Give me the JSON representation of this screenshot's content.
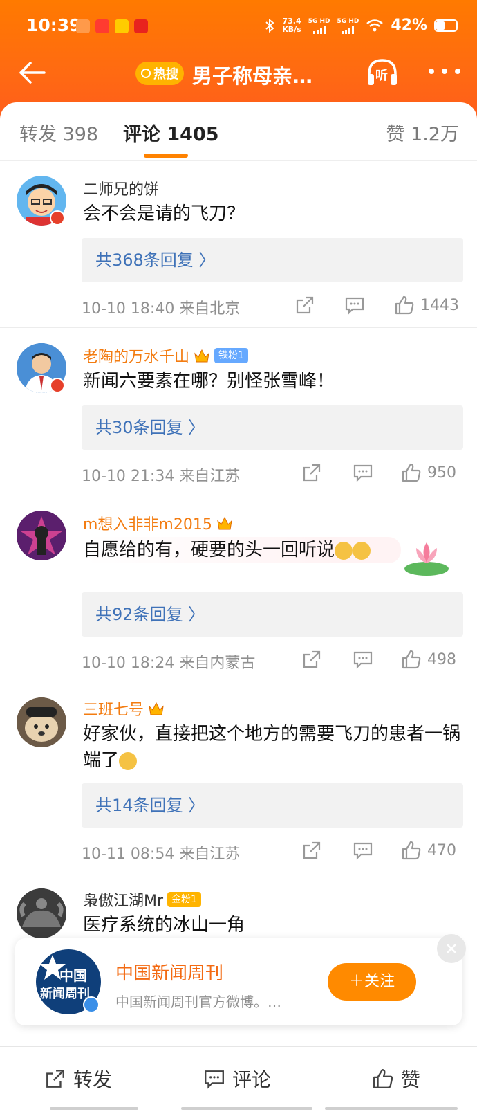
{
  "status_bar": {
    "time": "10:39",
    "net_speed": "73.4",
    "net_unit": "KB/s",
    "sig1": "5G HD",
    "sig2": "5G HD",
    "battery": "42%",
    "battery_level": 0.42
  },
  "nav": {
    "hot_label": "热搜",
    "title": "男子称母亲…",
    "listen_label": "听"
  },
  "tabs": {
    "repost": "转发 398",
    "comment": "评论 1405",
    "like": "赞 1.2万"
  },
  "comments": [
    {
      "user": "二师兄的饼",
      "text": "会不会是请的飞刀？",
      "replies": "共368条回复 〉",
      "meta": "10-10 18:40  来自北京",
      "likes": "1443"
    },
    {
      "user": "老陶的万水千山",
      "fan_tag": "铁粉1",
      "text": "新闻六要素在哪？别怪张雪峰！",
      "replies": "共30条回复 〉",
      "meta": "10-10 21:34  来自江苏",
      "likes": "950"
    },
    {
      "user": "m想入非非m2015",
      "text": "自愿给的有，硬要的头一回听说",
      "replies": "共92条回复 〉",
      "meta": "10-10 18:24  来自内蒙古",
      "likes": "498"
    },
    {
      "user": "三班七号",
      "text": "好家伙，直接把这个地方的需要飞刀的患者一锅端了",
      "replies": "共14条回复 〉",
      "meta": "10-11 08:54  来自江苏",
      "likes": "470"
    },
    {
      "user": "枭傲江湖Mr",
      "fan_tag": "金粉1",
      "text": "医疗系统的冰山一角"
    }
  ],
  "follow_card": {
    "avatar_text_1": "中国",
    "avatar_text_2": "新闻周刊",
    "name": "中国新闻周刊",
    "desc": "中国新闻周刊官方微博。…",
    "follow_label": "＋关注"
  },
  "bottom_bar": {
    "repost": "转发",
    "comment": "评论",
    "like": "赞"
  },
  "colors": {
    "accent": "#ff8200",
    "link": "#3f72b8",
    "username_orange": "#f37c11",
    "follow": "#ff8a00"
  }
}
